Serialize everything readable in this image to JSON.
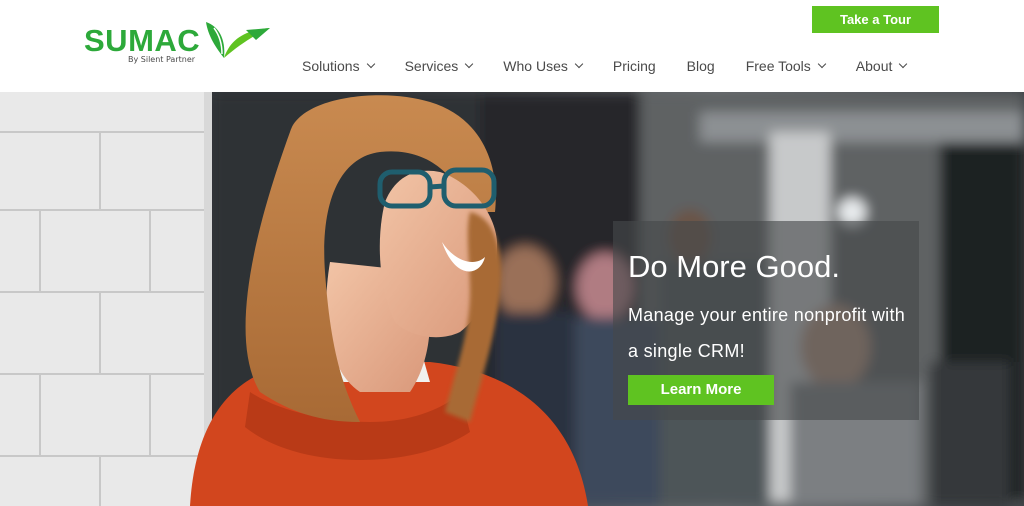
{
  "brand": {
    "name": "SUMAC",
    "tagline": "By Silent Partner",
    "color": "#2da93a"
  },
  "header": {
    "tour_button": "Take a Tour",
    "accent_color": "#5fc321"
  },
  "nav": {
    "items": [
      {
        "label": "Solutions",
        "dropdown": true
      },
      {
        "label": "Services",
        "dropdown": true
      },
      {
        "label": "Who Uses",
        "dropdown": true
      },
      {
        "label": "Pricing",
        "dropdown": false
      },
      {
        "label": "Blog",
        "dropdown": false
      },
      {
        "label": "Free Tools",
        "dropdown": true
      },
      {
        "label": "About",
        "dropdown": true
      }
    ]
  },
  "hero": {
    "headline": "Do More Good.",
    "subline": "Manage your entire nonprofit with a single CRM!",
    "cta_button": "Learn More",
    "image_description_icon": "hero-photo"
  }
}
